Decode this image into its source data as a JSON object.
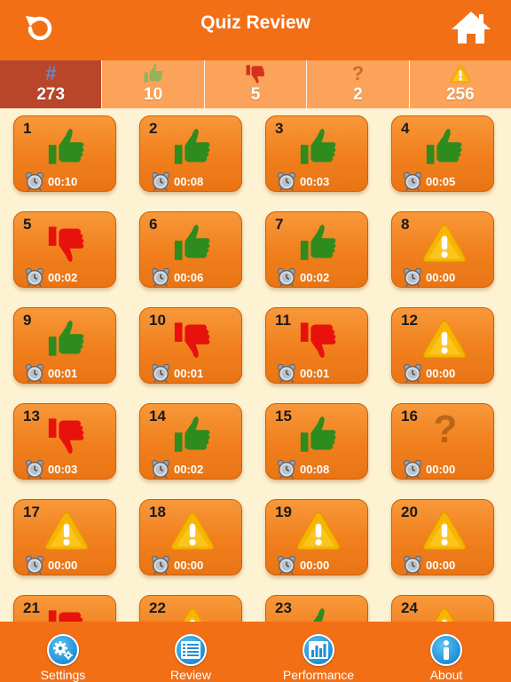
{
  "header": {
    "title": "Quiz Review"
  },
  "stats": [
    {
      "icon": "hash-icon",
      "value": "273"
    },
    {
      "icon": "thumbs-up-icon",
      "value": "10"
    },
    {
      "icon": "thumbs-down-icon",
      "value": "5"
    },
    {
      "icon": "question-mark-icon",
      "value": "2"
    },
    {
      "icon": "warning-icon",
      "value": "256"
    }
  ],
  "questions": [
    {
      "number": "1",
      "result": "correct",
      "time": "00:10"
    },
    {
      "number": "2",
      "result": "correct",
      "time": "00:08"
    },
    {
      "number": "3",
      "result": "correct",
      "time": "00:03"
    },
    {
      "number": "4",
      "result": "correct",
      "time": "00:05"
    },
    {
      "number": "5",
      "result": "wrong",
      "time": "00:02"
    },
    {
      "number": "6",
      "result": "correct",
      "time": "00:06"
    },
    {
      "number": "7",
      "result": "correct",
      "time": "00:02"
    },
    {
      "number": "8",
      "result": "unanswered",
      "time": "00:00"
    },
    {
      "number": "9",
      "result": "correct",
      "time": "00:01"
    },
    {
      "number": "10",
      "result": "wrong",
      "time": "00:01"
    },
    {
      "number": "11",
      "result": "wrong",
      "time": "00:01"
    },
    {
      "number": "12",
      "result": "unanswered",
      "time": "00:00"
    },
    {
      "number": "13",
      "result": "wrong",
      "time": "00:03"
    },
    {
      "number": "14",
      "result": "correct",
      "time": "00:02"
    },
    {
      "number": "15",
      "result": "correct",
      "time": "00:08"
    },
    {
      "number": "16",
      "result": "unsure",
      "time": "00:00"
    },
    {
      "number": "17",
      "result": "unanswered",
      "time": "00:00"
    },
    {
      "number": "18",
      "result": "unanswered",
      "time": "00:00"
    },
    {
      "number": "19",
      "result": "unanswered",
      "time": "00:00"
    },
    {
      "number": "20",
      "result": "unanswered",
      "time": "00:00"
    },
    {
      "number": "21",
      "result": "wrong",
      "time": ""
    },
    {
      "number": "22",
      "result": "unanswered",
      "time": ""
    },
    {
      "number": "23",
      "result": "correct",
      "time": ""
    },
    {
      "number": "24",
      "result": "unanswered",
      "time": ""
    }
  ],
  "nav": [
    {
      "label": "Settings",
      "icon": "gears-icon"
    },
    {
      "label": "Review",
      "icon": "list-icon"
    },
    {
      "label": "Performance",
      "icon": "bar-chart-icon"
    },
    {
      "label": "About",
      "icon": "info-icon"
    }
  ],
  "colors": {
    "header": "#f26f16",
    "background": "#fdf3d3",
    "correct": "#2e8b1e",
    "wrong": "#e8120c",
    "warning": "#f5a800"
  }
}
